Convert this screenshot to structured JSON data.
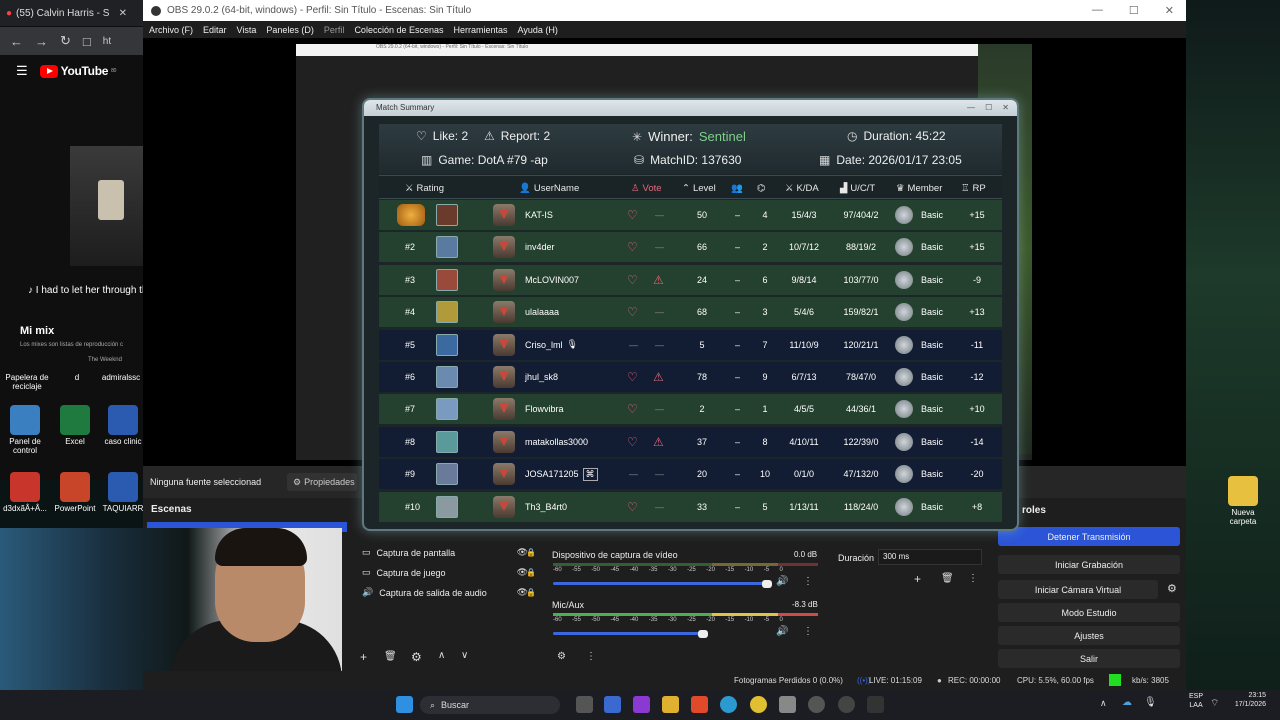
{
  "browser": {
    "tab_title": "(55) Calvin Harris - S",
    "tab_close": "✕",
    "nav_icons": [
      "←",
      "→",
      "↻",
      "□",
      "ht"
    ],
    "brand": "YouTube",
    "brand_sup": "80",
    "caption": "♪ I had to let her through the",
    "mix_title": "Mi mix",
    "mix_sub": "Los mixes son listas de reproducción c",
    "mix_artist": "The Weeknd"
  },
  "desktop": {
    "left_icons": [
      {
        "label": "Papelera de reciclaje",
        "color": "#4a7fa0"
      },
      {
        "label": "d",
        "color": "#333"
      },
      {
        "label": "admiralssc",
        "color": "#333"
      },
      {
        "label": "Panel de control",
        "color": "#3a7fc0"
      },
      {
        "label": "Excel",
        "color": "#1e7a3e"
      },
      {
        "label": "caso clinic",
        "color": "#2b5bb0"
      },
      {
        "label": "d3dxãÂ+Â...",
        "color": "#c8352a"
      },
      {
        "label": "PowerPoint",
        "color": "#c8452a"
      },
      {
        "label": "TAQUIARR",
        "color": "#2b5bb0"
      }
    ],
    "right_icon": {
      "label": "Nueva carpeta",
      "color": "#e8c040"
    }
  },
  "obs": {
    "title": "OBS 29.0.2 (64-bit, windows) - Perfil: Sin Título - Escenas: Sin Título",
    "window_controls": [
      "—",
      "☐",
      "✕"
    ],
    "menu": [
      "Archivo (F)",
      "Editar",
      "Vista",
      "Paneles (D)",
      "Perfil",
      "Colección de Escenas",
      "Herramientas",
      "Ayuda (H)"
    ],
    "no_source": "Ninguna fuente seleccionad",
    "properties": "Propiedades",
    "scenes_title": "Escenas",
    "controls_title": "roles",
    "sources": [
      {
        "name": "Captura de pantalla",
        "icon": "▭"
      },
      {
        "name": "Captura de juego",
        "icon": "▭"
      },
      {
        "name": "Captura de salida de audio",
        "icon": "🔊"
      }
    ],
    "mixer": [
      {
        "name": "Dispositivo de captura de vídeo",
        "db": "0.0 dB"
      },
      {
        "name": "Mic/Aux",
        "db": "-8.3 dB"
      }
    ],
    "meter_ticks": [
      "-60",
      "-55",
      "-50",
      "-45",
      "-40",
      "-35",
      "-30",
      "-25",
      "-20",
      "-15",
      "-10",
      "-5",
      "0"
    ],
    "duration_label": "Duración",
    "duration_value": "300 ms",
    "controls": [
      {
        "label": "Detener Transmisión",
        "active": true
      },
      {
        "label": "Iniciar Grabación",
        "active": false
      },
      {
        "label": "Iniciar Cámara Virtual",
        "active": false
      },
      {
        "label": "Modo Estudio",
        "active": false
      },
      {
        "label": "Ajustes",
        "active": false
      },
      {
        "label": "Salir",
        "active": false
      }
    ],
    "status": {
      "dropped": "Fotogramas Perdidos 0 (0.0%)",
      "live": "LIVE: 01:15:09",
      "rec": "REC: 00:00:00",
      "cpu": "CPU: 5.5%, 60.00 fps",
      "kbs": "kb/s: 3805"
    },
    "inner_title": "OBS 29.0.2 (64-bit, windows) - Perfil: Sin Título - Escenas: Sin Título"
  },
  "match": {
    "window_title": "Match Summary",
    "like": "Like: 2",
    "report": "Report: 2",
    "winner_label": "Winner:",
    "winner_value": "Sentinel",
    "duration": "Duration: 45:22",
    "game": "Game: DotA #79 -ap",
    "match_id": "MatchID: 137630",
    "date": "Date: 2026/01/17 23:05",
    "columns": {
      "rating": "Rating",
      "username": "UserName",
      "vote": "Vote",
      "level": "Level",
      "kda": "K/DA",
      "uct": "U/C/T",
      "member": "Member",
      "rp": "RP"
    },
    "players": [
      {
        "rank": "",
        "name": "KAT-IS",
        "vote": "heart",
        "report": "—",
        "level": "50",
        "col1": "–",
        "col2": "4",
        "kda": "15/4/3",
        "uct": "97/404/2",
        "member": "Basic",
        "rp": "+15",
        "team": "g",
        "avatar": "#6a3a2a"
      },
      {
        "rank": "#2",
        "name": "inv4der",
        "vote": "heart",
        "report": "—",
        "level": "66",
        "col1": "–",
        "col2": "2",
        "kda": "10/7/12",
        "uct": "88/19/2",
        "member": "Basic",
        "rp": "+15",
        "team": "g",
        "avatar": "#5a7aa0"
      },
      {
        "rank": "#3",
        "name": "McLOVIN007",
        "vote": "heart",
        "report": "warn",
        "level": "24",
        "col1": "–",
        "col2": "6",
        "kda": "9/8/14",
        "uct": "103/77/0",
        "member": "Basic",
        "rp": "-9",
        "team": "g",
        "avatar": "#9a4a3a"
      },
      {
        "rank": "#4",
        "name": "ulalaaaa",
        "vote": "heart",
        "report": "—",
        "level": "68",
        "col1": "–",
        "col2": "3",
        "kda": "5/4/6",
        "uct": "159/82/1",
        "member": "Basic",
        "rp": "+13",
        "team": "g",
        "avatar": "#b09a3a"
      },
      {
        "rank": "#5",
        "name": "Criso_lml",
        "vote": "—",
        "report": "—",
        "level": "5",
        "col1": "–",
        "col2": "7",
        "kda": "11/10/9",
        "uct": "120/21/1",
        "member": "Basic",
        "rp": "-11",
        "team": "b",
        "avatar": "#3a6aa0"
      },
      {
        "rank": "#6",
        "name": "jhul_sk8",
        "vote": "heart",
        "report": "warn",
        "level": "78",
        "col1": "–",
        "col2": "9",
        "kda": "6/7/13",
        "uct": "78/47/0",
        "member": "Basic",
        "rp": "-12",
        "team": "b",
        "avatar": "#6a8ab0"
      },
      {
        "rank": "#7",
        "name": "Flowvibra",
        "vote": "heart",
        "report": "—",
        "level": "2",
        "col1": "–",
        "col2": "1",
        "kda": "4/5/5",
        "uct": "44/36/1",
        "member": "Basic",
        "rp": "+10",
        "team": "g",
        "avatar": "#7a9ac0"
      },
      {
        "rank": "#8",
        "name": "matakollas3000",
        "vote": "heart",
        "report": "warn",
        "level": "37",
        "col1": "–",
        "col2": "8",
        "kda": "4/10/11",
        "uct": "122/39/0",
        "member": "Basic",
        "rp": "-14",
        "team": "b",
        "avatar": "#5a9a9a"
      },
      {
        "rank": "#9",
        "name": "JOSA171205",
        "vote": "—",
        "report": "—",
        "level": "20",
        "col1": "–",
        "col2": "10",
        "kda": "0/1/0",
        "uct": "47/132/0",
        "member": "Basic",
        "rp": "-20",
        "team": "b",
        "avatar": "#6a7a9a"
      },
      {
        "rank": "#10",
        "name": "Th3_B4rt0",
        "vote": "heart",
        "report": "—",
        "level": "33",
        "col1": "–",
        "col2": "5",
        "kda": "1/13/11",
        "uct": "118/24/0",
        "member": "Basic",
        "rp": "+8",
        "team": "g",
        "avatar": "#8a9aa0"
      }
    ]
  },
  "taskbar": {
    "search": "Buscar",
    "lang1": "ESP",
    "lang2": "LAA",
    "time": "23:15",
    "date": "17/1/2026"
  }
}
